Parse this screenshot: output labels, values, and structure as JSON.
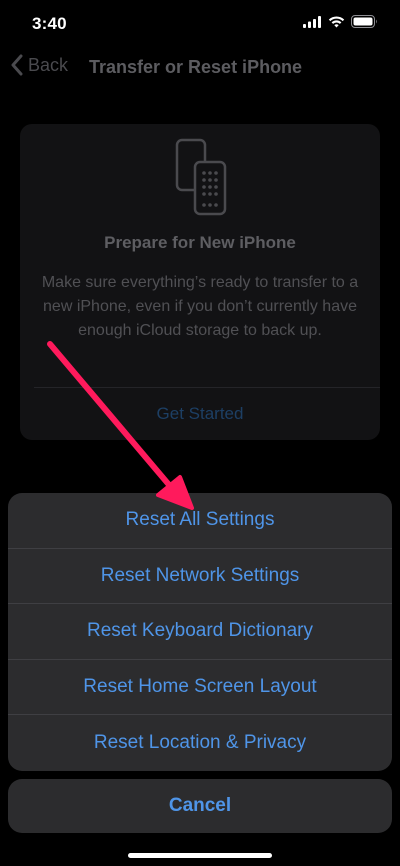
{
  "status_bar": {
    "time": "3:40"
  },
  "nav": {
    "back_label": "Back",
    "title": "Transfer or Reset iPhone"
  },
  "card": {
    "title": "Prepare for New iPhone",
    "description": "Make sure everything’s ready to transfer to a new iPhone, even if you don’t currently have enough iCloud storage to back up.",
    "link": "Get Started"
  },
  "action_sheet": {
    "items": [
      {
        "label": "Reset All Settings"
      },
      {
        "label": "Reset Network Settings"
      },
      {
        "label": "Reset Keyboard Dictionary"
      },
      {
        "label": "Reset Home Screen Layout"
      },
      {
        "label": "Reset Location & Privacy"
      }
    ],
    "cancel": "Cancel"
  },
  "colors": {
    "action_blue": "#4f95e8",
    "annotation_arrow": "#ff1a5c",
    "sheet_bg": "#2c2c2e"
  },
  "icons": [
    "cellular-signal-icon",
    "wifi-icon",
    "battery-icon",
    "chevron-left-icon",
    "transfer-phones-icon",
    "annotation-arrow"
  ]
}
